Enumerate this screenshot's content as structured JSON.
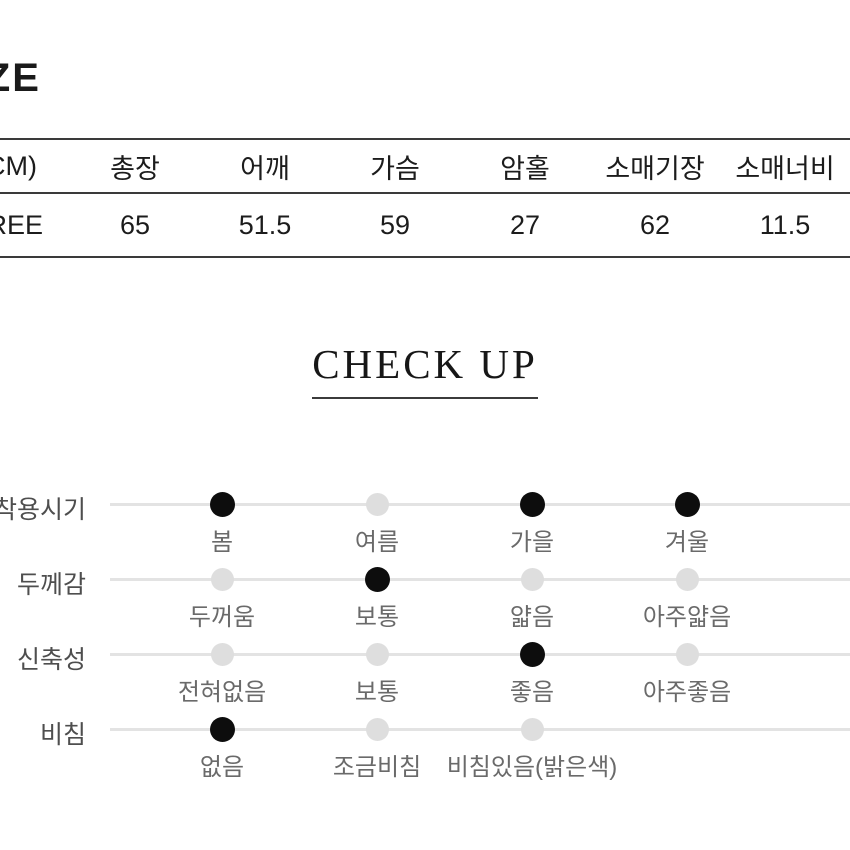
{
  "page": {
    "background": "#ffffff",
    "accent_dark": "#0d0d0d",
    "inactive_dot": "#dedede",
    "track_color": "#e3e3e3"
  },
  "size_section": {
    "heading": "SIZE",
    "table": {
      "headers": [
        "(CM)",
        "총장",
        "어깨",
        "가슴",
        "암홀",
        "소매기장",
        "소매너비"
      ],
      "rows": [
        [
          "FREE",
          "65",
          "51.5",
          "59",
          "27",
          "62",
          "11.5"
        ]
      ]
    }
  },
  "checkup_section": {
    "title": "CHECK UP",
    "rows": [
      {
        "label": "착용시기",
        "options": [
          {
            "label": "봄",
            "selected": true
          },
          {
            "label": "여름",
            "selected": false
          },
          {
            "label": "가을",
            "selected": true
          },
          {
            "label": "겨울",
            "selected": true
          }
        ]
      },
      {
        "label": "두께감",
        "options": [
          {
            "label": "두꺼움",
            "selected": false
          },
          {
            "label": "보통",
            "selected": true
          },
          {
            "label": "얇음",
            "selected": false
          },
          {
            "label": "아주얇음",
            "selected": false
          }
        ]
      },
      {
        "label": "신축성",
        "options": [
          {
            "label": "전혀없음",
            "selected": false
          },
          {
            "label": "보통",
            "selected": false
          },
          {
            "label": "좋음",
            "selected": true
          },
          {
            "label": "아주좋음",
            "selected": false
          }
        ]
      },
      {
        "label": "비침",
        "options": [
          {
            "label": "없음",
            "selected": true
          },
          {
            "label": "조금비침",
            "selected": false
          },
          {
            "label": "비침있음(밝은색)",
            "selected": false
          }
        ]
      }
    ]
  }
}
